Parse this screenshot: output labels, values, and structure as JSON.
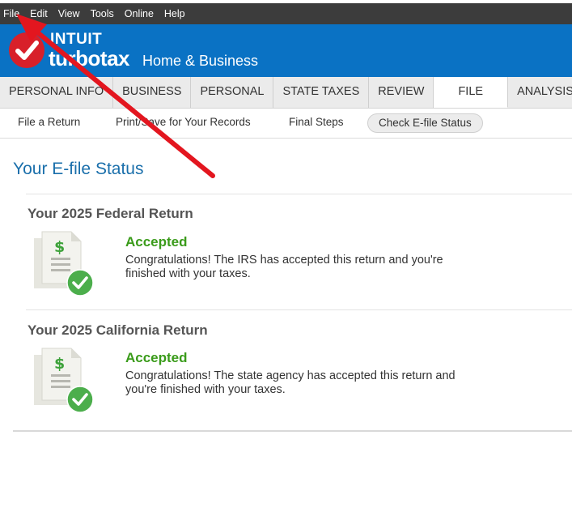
{
  "menu": [
    "File",
    "Edit",
    "View",
    "Tools",
    "Online",
    "Help"
  ],
  "brand": {
    "intuit": "INTUIT",
    "product": "turbotax",
    "edition": "Home & Business",
    "logo_color": "#d8202a",
    "banner_color": "#0a72c4"
  },
  "tabs": [
    {
      "label": "PERSONAL INFO",
      "active": false
    },
    {
      "label": "BUSINESS",
      "active": false
    },
    {
      "label": "PERSONAL",
      "active": false
    },
    {
      "label": "STATE TAXES",
      "active": false
    },
    {
      "label": "REVIEW",
      "active": false
    },
    {
      "label": "FILE",
      "active": true
    },
    {
      "label": "ANALYSIS & ADVICE",
      "active": false
    }
  ],
  "subnav": [
    {
      "label": "File a Return"
    },
    {
      "label": "Print/Save for Your Records"
    },
    {
      "label": "Final Steps"
    },
    {
      "label": "Check E-file Status",
      "selected": true
    }
  ],
  "page": {
    "title": "Your E-file Status"
  },
  "returns": [
    {
      "title": "Your 2025 Federal Return",
      "status": "Accepted",
      "message": "Congratulations! The IRS has accepted this return and you're finished with your taxes."
    },
    {
      "title": "Your 2025 California Return",
      "status": "Accepted",
      "message": "Congratulations! The state agency has accepted this return and you're finished with your taxes."
    }
  ],
  "colors": {
    "accepted": "#3a9b1a",
    "title_blue": "#1a6fab",
    "annotation_arrow": "#e3161f"
  },
  "icons": {
    "document": "document-dollar-icon",
    "check": "green-check-icon",
    "annotation": "red-arrow-annotation"
  }
}
